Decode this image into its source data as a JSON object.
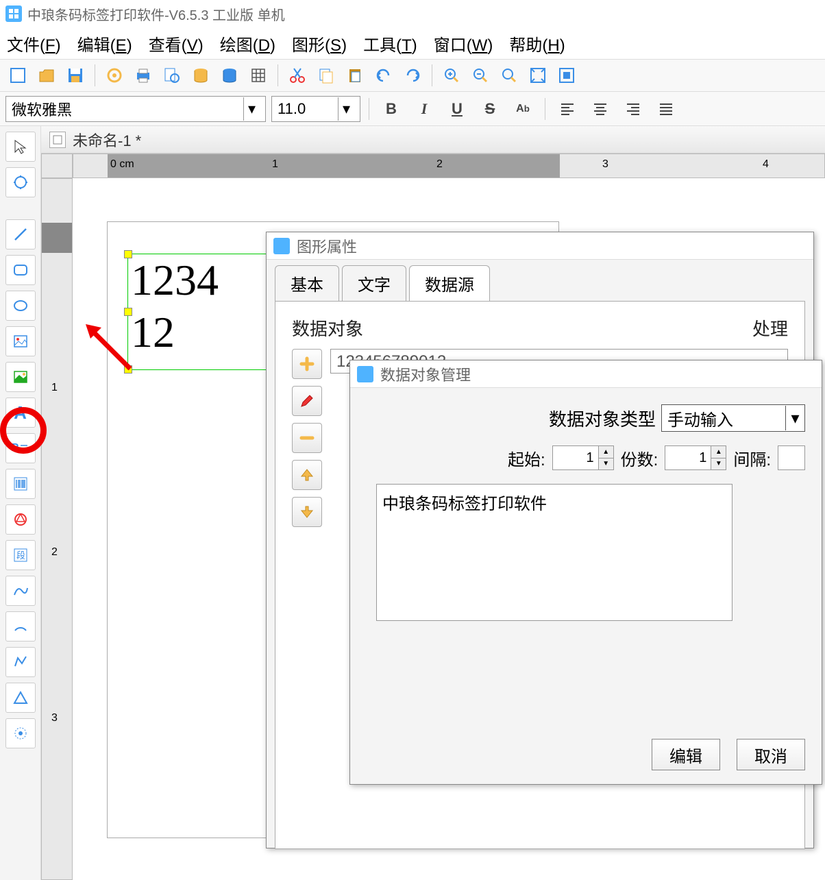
{
  "app": {
    "title": "中琅条码标签打印软件-V6.5.3 工业版 单机"
  },
  "menu": {
    "file": "文件(F)",
    "edit": "编辑(E)",
    "view": "查看(V)",
    "draw": "绘图(D)",
    "shape": "图形(S)",
    "tools": "工具(T)",
    "window": "窗口(W)",
    "help": "帮助(H)"
  },
  "format": {
    "font": "微软雅黑",
    "size": "11.0"
  },
  "document": {
    "tab_name": "未命名-1 *"
  },
  "ruler": {
    "h0": "0 cm",
    "h1": "1",
    "h2": "2",
    "h3": "3",
    "h4": "4",
    "v1": "1",
    "v2": "2",
    "v3": "3"
  },
  "canvas": {
    "text1": "1234",
    "text2": "12"
  },
  "dialog_props": {
    "title": "图形属性",
    "tabs": {
      "basic": "基本",
      "text": "文字",
      "datasource": "数据源"
    },
    "section_data": "数据对象",
    "section_process": "处理",
    "data_value": "123456789012"
  },
  "dialog_data": {
    "title": "数据对象管理",
    "type_label": "数据对象类型",
    "type_value": "手动输入",
    "start_label": "起始:",
    "start_value": "1",
    "count_label": "份数:",
    "count_value": "1",
    "interval_label": "间隔:",
    "content": "中琅条码标签打印软件",
    "btn_edit": "编辑",
    "btn_cancel": "取消"
  }
}
